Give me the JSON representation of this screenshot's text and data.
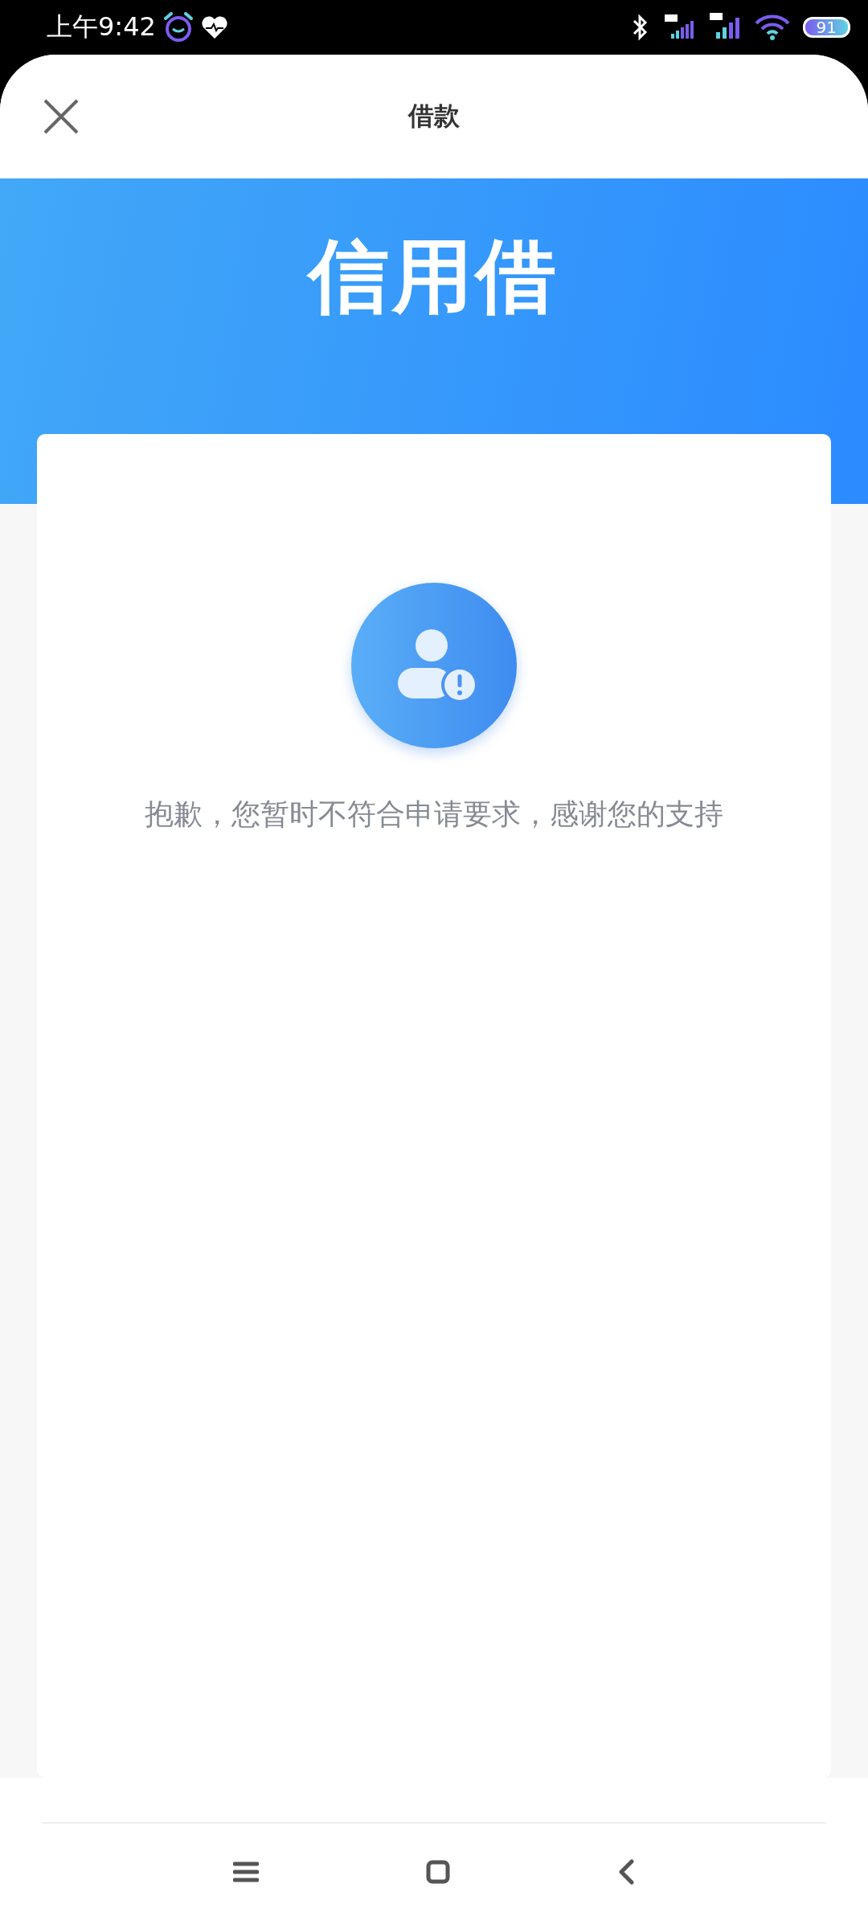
{
  "status_bar": {
    "time": "上午9:42",
    "battery": "91"
  },
  "header": {
    "title": "借款"
  },
  "banner": {
    "title": "信用借"
  },
  "result": {
    "message": "抱歉，您暂时不符合申请要求，感谢您的支持"
  }
}
